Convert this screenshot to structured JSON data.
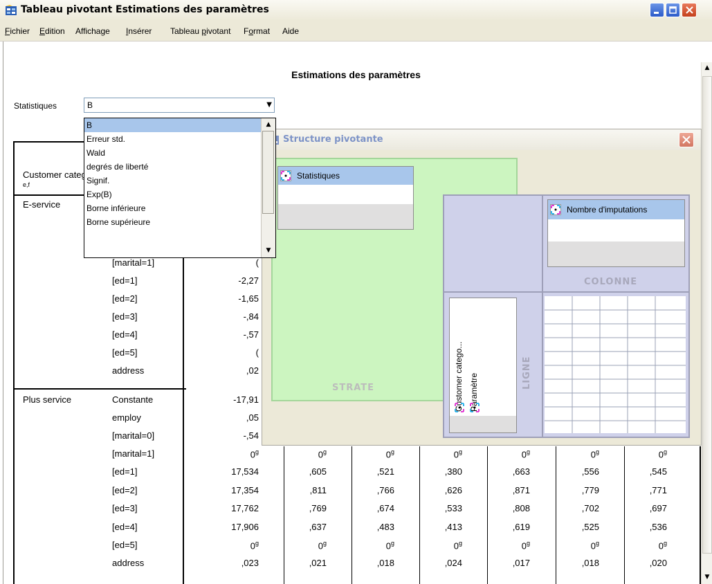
{
  "window": {
    "title": "Tableau pivotant Estimations des paramètres",
    "buttons": [
      "minimize",
      "maximize",
      "close"
    ]
  },
  "menu": [
    {
      "mnemonic": "F",
      "rest": "ichier"
    },
    {
      "mnemonic": "E",
      "rest": "dition"
    },
    {
      "mnemonic": "",
      "rest": "Affichage"
    },
    {
      "mnemonic": "I",
      "rest": "nsérer"
    },
    {
      "pre": "Tableau ",
      "mnemonic": "p",
      "rest": "ivotant"
    },
    {
      "pre": "F",
      "mnemonic": "o",
      "rest": "rmat"
    },
    {
      "mnemonic": "",
      "rest": "Aide"
    }
  ],
  "table": {
    "title": "Estimations des paramètres",
    "layer_label": "Statistiques",
    "layer_value": "B",
    "row_header": "Customer category",
    "row_header_superscript": "e,f"
  },
  "dropdown": {
    "options": [
      "B",
      "Erreur std.",
      "Wald",
      "degrés de liberté",
      "Signif.",
      "Exp(B)",
      "Borne inférieure",
      "Borne supérieure"
    ],
    "selected": 0
  },
  "groups": [
    {
      "label": "E-service",
      "row_index": 0
    },
    {
      "label": "Plus service",
      "row_index": 9
    }
  ],
  "rows": [
    {
      "param": "",
      "value": ""
    },
    {
      "param": "",
      "value": ""
    },
    {
      "param": "",
      "value": ""
    },
    {
      "param": "[marital=1]",
      "value": "("
    },
    {
      "param": "[ed=1]",
      "value": "-2,27"
    },
    {
      "param": "[ed=2]",
      "value": "-1,65"
    },
    {
      "param": "[ed=3]",
      "value": "-,84"
    },
    {
      "param": "[ed=4]",
      "value": "-,57"
    },
    {
      "param": "[ed=5]",
      "value": "("
    },
    {
      "param": "address",
      "value": ",02"
    },
    {
      "param": "Constante",
      "value": "-17,91"
    },
    {
      "param": "employ",
      "value": ",05"
    },
    {
      "param": "[marital=0]",
      "value": "-,54"
    }
  ],
  "full_rows": [
    {
      "param": "[marital=1]",
      "values": [
        "0",
        "0",
        "0",
        "0",
        "0",
        "0",
        "0"
      ],
      "sup": "g"
    },
    {
      "param": "[ed=1]",
      "values": [
        "17,534",
        ",605",
        ",521",
        ",380",
        ",663",
        ",556",
        ",545"
      ],
      "sup": ""
    },
    {
      "param": "[ed=2]",
      "values": [
        "17,354",
        ",811",
        ",766",
        ",626",
        ",871",
        ",779",
        ",771"
      ],
      "sup": ""
    },
    {
      "param": "[ed=3]",
      "values": [
        "17,762",
        ",769",
        ",674",
        ",533",
        ",808",
        ",702",
        ",697"
      ],
      "sup": ""
    },
    {
      "param": "[ed=4]",
      "values": [
        "17,906",
        ",637",
        ",483",
        ",413",
        ",619",
        ",525",
        ",536"
      ],
      "sup": ""
    },
    {
      "param": "[ed=5]",
      "values": [
        "0",
        "0",
        "0",
        "0",
        "0",
        "0",
        "0"
      ],
      "sup": "g"
    },
    {
      "param": "address",
      "values": [
        ",023",
        ",021",
        ",018",
        ",024",
        ",017",
        ",018",
        ",020"
      ],
      "sup": ""
    }
  ],
  "pivot_dialog": {
    "title": "Structure pivotante",
    "layer_field": "Statistiques",
    "column_field": "Nombre d'imputations",
    "row_fields": [
      "Customer catego...",
      "Paramètre"
    ],
    "zone_labels": {
      "layer": "STRATE",
      "column": "COLONNE",
      "row": "LIGNE"
    }
  }
}
